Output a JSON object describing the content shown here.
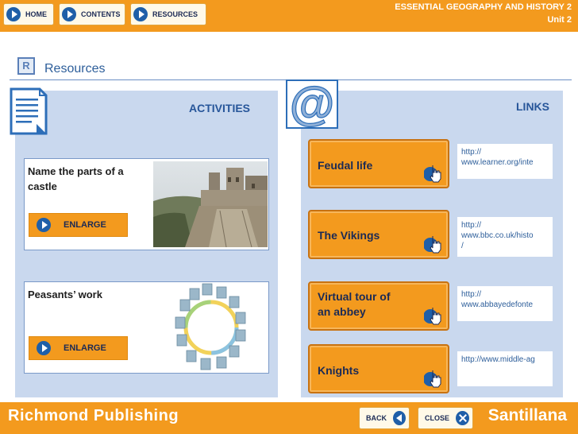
{
  "nav": {
    "home_label": "HOME",
    "contents_label": "CONTENTS",
    "resources_label": "RESOURCES"
  },
  "header": {
    "title": "ESSENTIAL GEOGRAPHY AND HISTORY 2",
    "unit": "Unit 2"
  },
  "section": {
    "badge": "R",
    "title": "Resources"
  },
  "activities": {
    "title": "ACTIVITIES",
    "items": [
      {
        "label": "Name the parts of a castle",
        "button": "ENLARGE"
      },
      {
        "label": "Peasants’ work",
        "button": "ENLARGE"
      }
    ]
  },
  "links": {
    "title": "LINKS",
    "items": [
      {
        "label": "Feudal life",
        "url_line1": "http://",
        "url_line2": "www.learner.org/inte",
        "url_line3": ""
      },
      {
        "label": "The Vikings",
        "url_line1": "http://",
        "url_line2": "www.bbc.co.uk/histo",
        "url_line3": "/"
      },
      {
        "label": "Virtual tour of an abbey",
        "url_line1": "http://",
        "url_line2": "www.abbayedefonte",
        "url_line3": ""
      },
      {
        "label": "Knights",
        "url_line1": "http://www.middle-ag",
        "url_line2": "",
        "url_line3": ""
      }
    ]
  },
  "footer": {
    "brand_left": "Richmond Publishing",
    "brand_right": "Santillana",
    "back_label": "BACK",
    "close_label": "CLOSE"
  },
  "colors": {
    "accent": "#f39a1e",
    "panel": "#c9d8ee",
    "nav_blue": "#1f5fa8"
  },
  "icons": [
    "document-icon",
    "at-sign-icon",
    "play-icon",
    "hand-cursor-icon",
    "back-arrow-icon",
    "close-icon"
  ]
}
